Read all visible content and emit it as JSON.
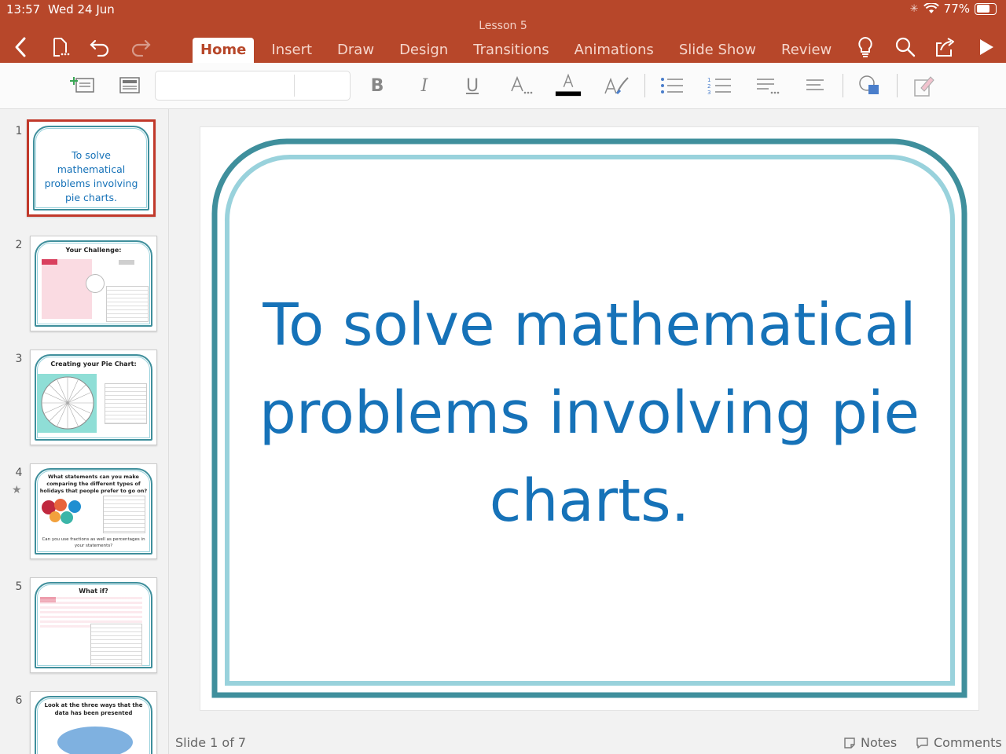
{
  "status": {
    "time": "13:57",
    "date": "Wed 24 Jun",
    "battery": "77%",
    "battery_level": 0.77
  },
  "doc": {
    "title": "Lesson 5"
  },
  "tabs": [
    {
      "label": "Home",
      "active": true
    },
    {
      "label": "Insert"
    },
    {
      "label": "Draw"
    },
    {
      "label": "Design"
    },
    {
      "label": "Transitions"
    },
    {
      "label": "Animations"
    },
    {
      "label": "Slide Show"
    },
    {
      "label": "Review"
    }
  ],
  "ribbon": {
    "bold": "B",
    "italic": "I",
    "underline": "U",
    "font_size_icon": "A",
    "font_color_icon": "A",
    "font_color": "#000000"
  },
  "thumbnails": [
    {
      "number": "1",
      "title": "To solve mathematical problems involving pie charts.",
      "selected": true
    },
    {
      "number": "2",
      "title": "Your Challenge:"
    },
    {
      "number": "3",
      "title": "Creating your Pie Chart:"
    },
    {
      "number": "4",
      "title": "What statements can you make comparing the different types of holidays that people prefer to go on?",
      "footer": "Can you use fractions as well as percentages in your statements?"
    },
    {
      "number": "5",
      "title": "What if?"
    },
    {
      "number": "6",
      "title": "Look at the three ways that the data has been presented"
    }
  ],
  "slide": {
    "title_lines": [
      "To solve mathematical",
      "problems involving pie",
      "charts."
    ]
  },
  "bottom": {
    "slide_count": "Slide 1 of 7",
    "notes": "Notes",
    "comments": "Comments"
  },
  "colors": {
    "brand": "#b7472a",
    "slide_text": "#1672b8",
    "frame_dark": "#3f8f9c",
    "frame_light": "#99d2dc"
  }
}
